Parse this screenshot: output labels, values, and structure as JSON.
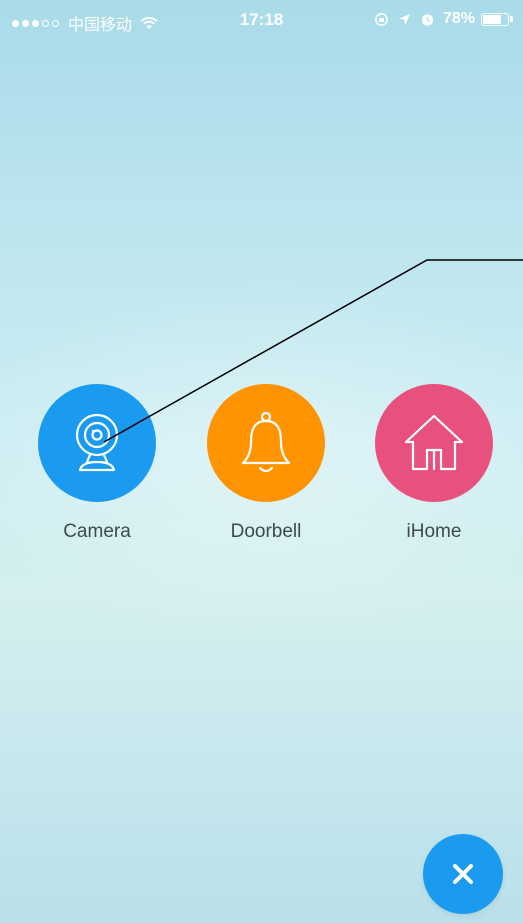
{
  "status_bar": {
    "carrier": "中国移动",
    "time": "17:18",
    "battery_percent": "78%",
    "battery_level": 0.78,
    "icons": [
      "signal-dots-icon",
      "wifi-icon",
      "orientation-lock-icon",
      "location-arrow-icon",
      "alarm-icon",
      "battery-icon"
    ]
  },
  "devices": [
    {
      "label": "Camera",
      "icon": "webcam-icon",
      "color": "#1a9bf0"
    },
    {
      "label": "Doorbell",
      "icon": "bell-icon",
      "color": "#ff9300"
    },
    {
      "label": "iHome",
      "icon": "house-icon",
      "color": "#e8517e"
    }
  ],
  "close_button": {
    "icon": "close-icon",
    "color": "#1a9bf0"
  },
  "colors": {
    "background_top": "#a9dbe9",
    "background_bottom": "#b9e0ea",
    "label_text": "#3e4a50"
  }
}
